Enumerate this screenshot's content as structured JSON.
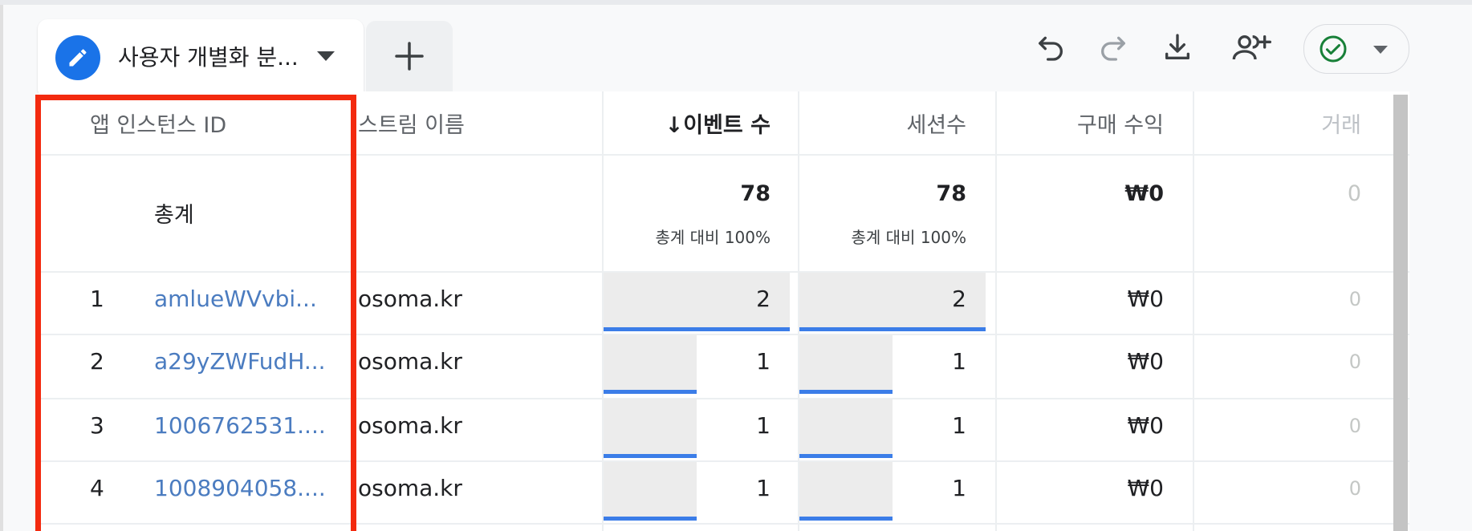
{
  "tab": {
    "title": "사용자 개별화 분...",
    "add_label": "+"
  },
  "toolbar": {
    "icons": [
      "undo-icon",
      "redo-icon",
      "download-icon",
      "share-users-icon",
      "check-circle-icon"
    ]
  },
  "colors": {
    "accent": "#1a73e8",
    "link": "#4b7cc0",
    "bar": "#3b7de8",
    "highlight": "#f32a0f",
    "ok": "#188038"
  },
  "table": {
    "headers": {
      "instance_id": "앱 인스턴스 ID",
      "stream": "스트림 이름",
      "events": "↓이벤트 수",
      "sessions": "세션수",
      "revenue": "구매 수익",
      "transactions": "거래"
    },
    "totals": {
      "label": "총계",
      "events": "78",
      "events_pct": "총계 대비 100%",
      "sessions": "78",
      "sessions_pct": "총계 대비 100%",
      "revenue": "₩0",
      "transactions": "0"
    },
    "rows": [
      {
        "num": "1",
        "id": "amlueWVvbi...",
        "stream": "osoma.kr",
        "events": "2",
        "sessions": "2",
        "revenue": "₩0",
        "transactions": "0",
        "events_frac": 1.0,
        "sessions_frac": 1.0
      },
      {
        "num": "2",
        "id": "a29yZWFudH...",
        "stream": "osoma.kr",
        "events": "1",
        "sessions": "1",
        "revenue": "₩0",
        "transactions": "0",
        "events_frac": 0.5,
        "sessions_frac": 0.5
      },
      {
        "num": "3",
        "id": "1006762531....",
        "stream": "osoma.kr",
        "events": "1",
        "sessions": "1",
        "revenue": "₩0",
        "transactions": "0",
        "events_frac": 0.5,
        "sessions_frac": 0.5
      },
      {
        "num": "4",
        "id": "1008904058....",
        "stream": "osoma.kr",
        "events": "1",
        "sessions": "1",
        "revenue": "₩0",
        "transactions": "0",
        "events_frac": 0.5,
        "sessions_frac": 0.5
      }
    ]
  }
}
